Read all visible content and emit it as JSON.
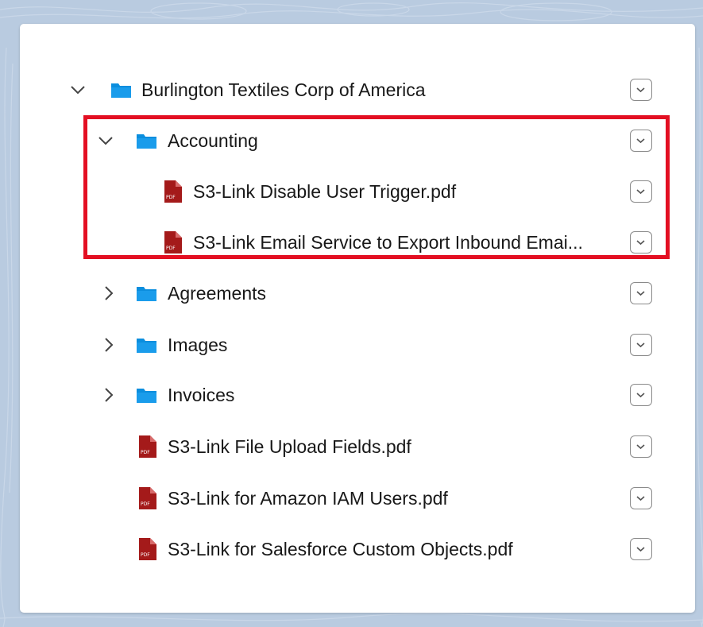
{
  "tree": {
    "root": {
      "label": "Burlington Textiles Corp of America",
      "type": "folder",
      "state": "expanded",
      "icon": "folder-icon"
    },
    "accounting": {
      "label": "Accounting",
      "type": "folder",
      "state": "expanded",
      "icon": "folder-icon"
    },
    "accounting_files": [
      {
        "label": "S3-Link Disable User Trigger.pdf",
        "type": "pdf",
        "icon": "pdf-icon"
      },
      {
        "label": "S3-Link Email Service to Export Inbound Emai...",
        "type": "pdf",
        "icon": "pdf-icon"
      }
    ],
    "folders": [
      {
        "label": "Agreements",
        "type": "folder",
        "state": "collapsed",
        "icon": "folder-icon"
      },
      {
        "label": "Images",
        "type": "folder",
        "state": "collapsed",
        "icon": "folder-icon"
      },
      {
        "label": "Invoices",
        "type": "folder",
        "state": "collapsed",
        "icon": "folder-icon"
      }
    ],
    "files": [
      {
        "label": "S3-Link File Upload Fields.pdf",
        "type": "pdf",
        "icon": "pdf-icon"
      },
      {
        "label": "S3-Link for Amazon IAM Users.pdf",
        "type": "pdf",
        "icon": "pdf-icon"
      },
      {
        "label": "S3-Link for Salesforce Custom Objects.pdf",
        "type": "pdf",
        "icon": "pdf-icon"
      }
    ]
  },
  "colors": {
    "folder": "#0b8ede",
    "pdf": "#a41a1a",
    "highlight": "#e30f22",
    "background": "#b9cbe0"
  }
}
